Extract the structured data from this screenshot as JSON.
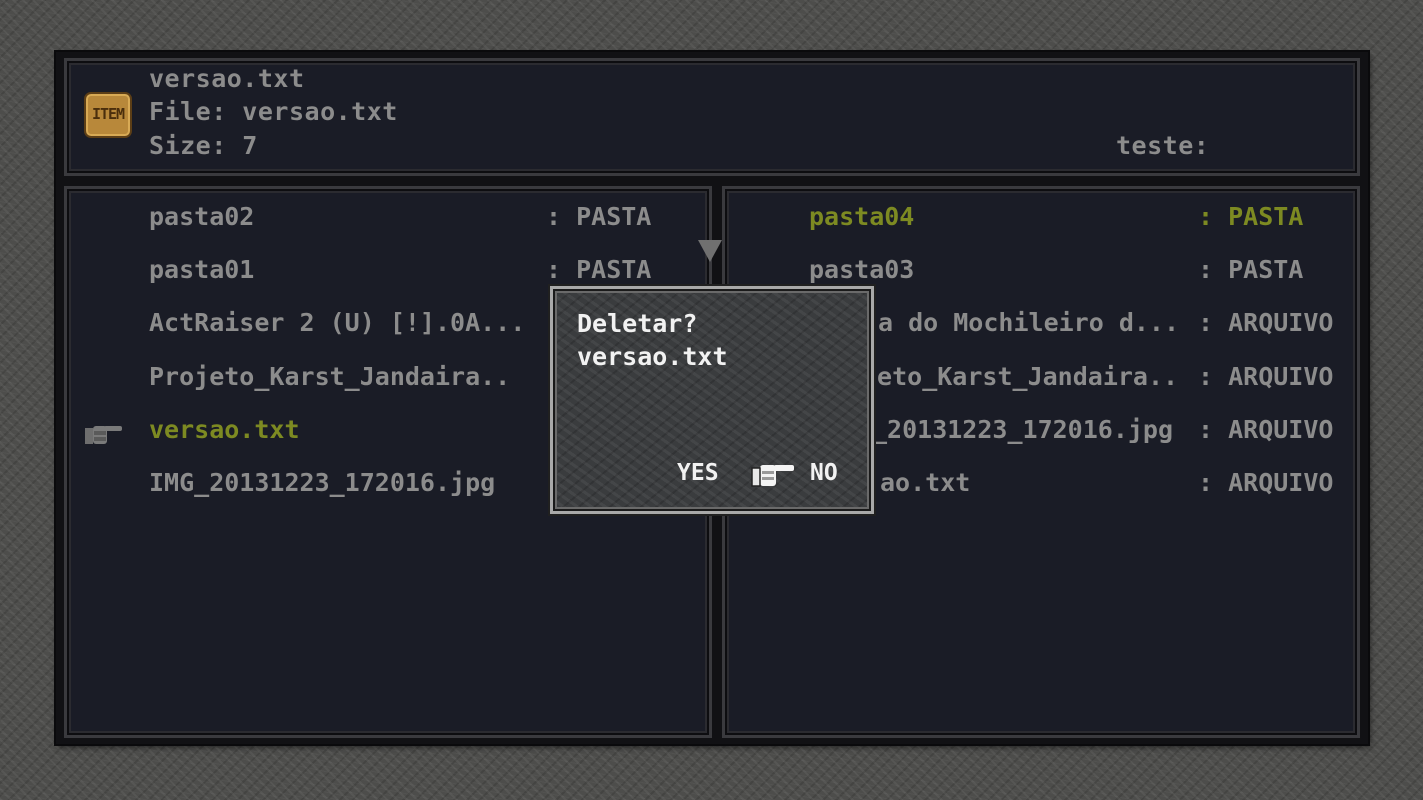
{
  "header": {
    "icon_label": "ITEM",
    "title": "versao.txt",
    "file_line": "File: versao.txt",
    "size_line": "Size: 7",
    "right_label": "teste:"
  },
  "left_list": [
    {
      "name": "pasta02",
      "type": ": PASTA"
    },
    {
      "name": "pasta01",
      "type": ": PASTA"
    },
    {
      "name": "ActRaiser 2 (U) [!].0A...",
      "type": ""
    },
    {
      "name": "Projeto_Karst_Jandaira..",
      "type": ""
    },
    {
      "name": "versao.txt",
      "type": ""
    },
    {
      "name": "IMG_20131223_172016.jpg",
      "type": ""
    }
  ],
  "right_list": [
    {
      "name": "pasta04",
      "type": ": PASTA"
    },
    {
      "name": "pasta03",
      "type": ": PASTA"
    },
    {
      "name": "a do Mochileiro d...",
      "type": ": ARQUIVO"
    },
    {
      "name": "jeto_Karst_Jandaira..",
      "type": ": ARQUIVO"
    },
    {
      "name": "_20131223_172016.jpg",
      "type": ": ARQUIVO"
    },
    {
      "name": "ao.txt",
      "type": ": ARQUIVO"
    }
  ],
  "dialog": {
    "question": "Deletar?",
    "filename": "versao.txt",
    "yes_label": "YES",
    "no_label": "NO"
  },
  "colors": {
    "highlight": "#7d8a22",
    "text": "#8c8c8c",
    "panel": "#1a1c26"
  }
}
